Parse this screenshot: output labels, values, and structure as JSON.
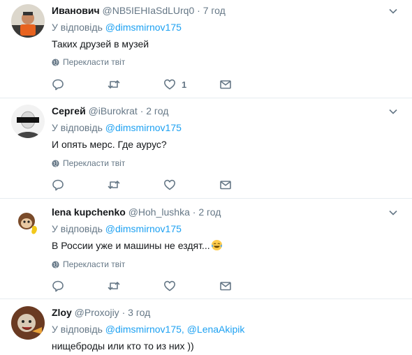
{
  "reply_prefix": "У відповідь",
  "translate_label": "Перекласти твіт",
  "tweets": [
    {
      "name": "Иванович",
      "handle": "@NB5IEHIaSdLUrq0",
      "time": "7 год",
      "reply_to": [
        "@dimsmirnov175"
      ],
      "text": "Таких друзей в музей",
      "like_count": "1"
    },
    {
      "name": "Сергей",
      "handle": "@iBurokrat",
      "time": "2 год",
      "reply_to": [
        "@dimsmirnov175"
      ],
      "text": "И опять мерс. Где аурус?"
    },
    {
      "name": "lena kupchenko",
      "handle": "@Hoh_lushka",
      "time": "2 год",
      "reply_to": [
        "@dimsmirnov175"
      ],
      "text": "В России уже и машины не ездят...",
      "emoji": "face-with-tears-of-joy"
    },
    {
      "name": "Zloy",
      "handle": "@Proxojiy",
      "time": "3 год",
      "reply_to": [
        "@dimsmirnov175,",
        "@LenaAkipik"
      ],
      "text": "нищеброды или кто то из них ))"
    }
  ],
  "colors": {
    "link": "#1da1f2",
    "secondary": "#657786",
    "divider": "#e6ecf0"
  },
  "icons": [
    "reply-icon",
    "retweet-icon",
    "like-icon",
    "direct-message-icon",
    "globe-icon",
    "chevron-down-icon"
  ]
}
